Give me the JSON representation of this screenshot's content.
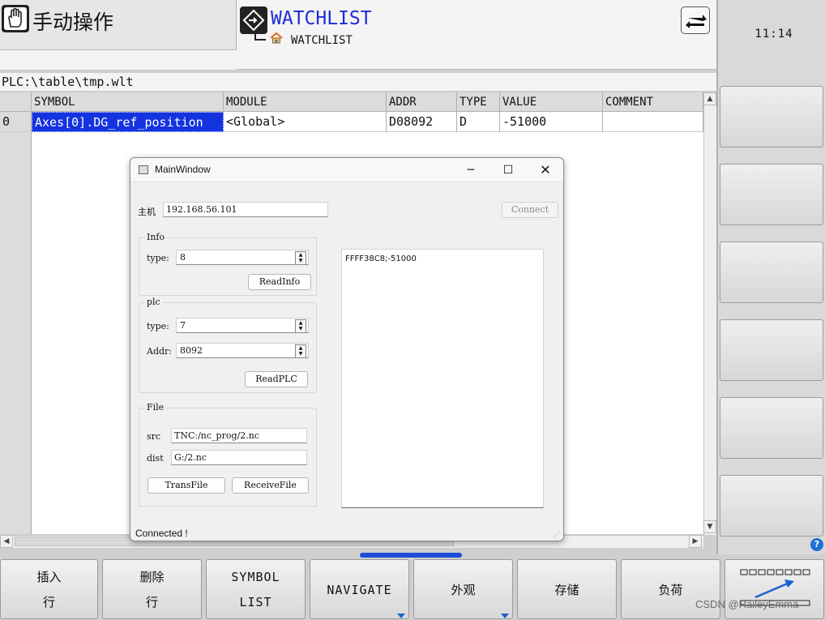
{
  "header": {
    "mode_title": "手动操作",
    "app_title": "WATCHLIST",
    "app_subtitle": "WATCHLIST",
    "clock": "11:14"
  },
  "file_path": "PLC:\\table\\tmp.wlt",
  "table": {
    "columns": [
      "SYMBOL",
      "MODULE",
      "ADDR",
      "TYPE",
      "VALUE",
      "COMMENT"
    ],
    "rows": [
      {
        "index": "0",
        "symbol": "Axes[0].DG_ref_position",
        "module": "<Global>",
        "addr": "D08092",
        "type": "D",
        "value": "-51000",
        "comment": ""
      }
    ]
  },
  "dialog": {
    "title": "MainWindow",
    "host_label": "主机",
    "host_value": "192.168.56.101",
    "connect_label": "Connect",
    "info_group": {
      "title": "Info",
      "type_label": "type:",
      "type_value": "8",
      "read_button": "ReadInfo"
    },
    "plc_group": {
      "title": "plc",
      "type_label": "type:",
      "type_value": "7",
      "addr_label": "Addr:",
      "addr_value": "8092",
      "read_button": "ReadPLC"
    },
    "file_group": {
      "title": "File",
      "src_label": "src",
      "src_value": "TNC:/nc_prog/2.nc",
      "dist_label": "dist",
      "dist_value": "G:/2.nc",
      "trans_button": "TransFile",
      "receive_button": "ReceiveFile"
    },
    "output_text": "FFFF38C8;-51000",
    "status": "Connected !"
  },
  "softkeys": [
    {
      "line1": "插入",
      "line2": "行"
    },
    {
      "line1": "删除",
      "line2": "行"
    },
    {
      "line1": "SYMBOL",
      "line2": "LIST"
    },
    {
      "label": "NAVIGATE"
    },
    {
      "label": "外观"
    },
    {
      "label": "存储"
    },
    {
      "label": "负荷"
    }
  ],
  "watermark": "CSDN @HaileyEmma",
  "colors": {
    "accent": "#1f2bd6",
    "selection": "#1433e0",
    "softkey_marker": "#1d5fd0"
  }
}
